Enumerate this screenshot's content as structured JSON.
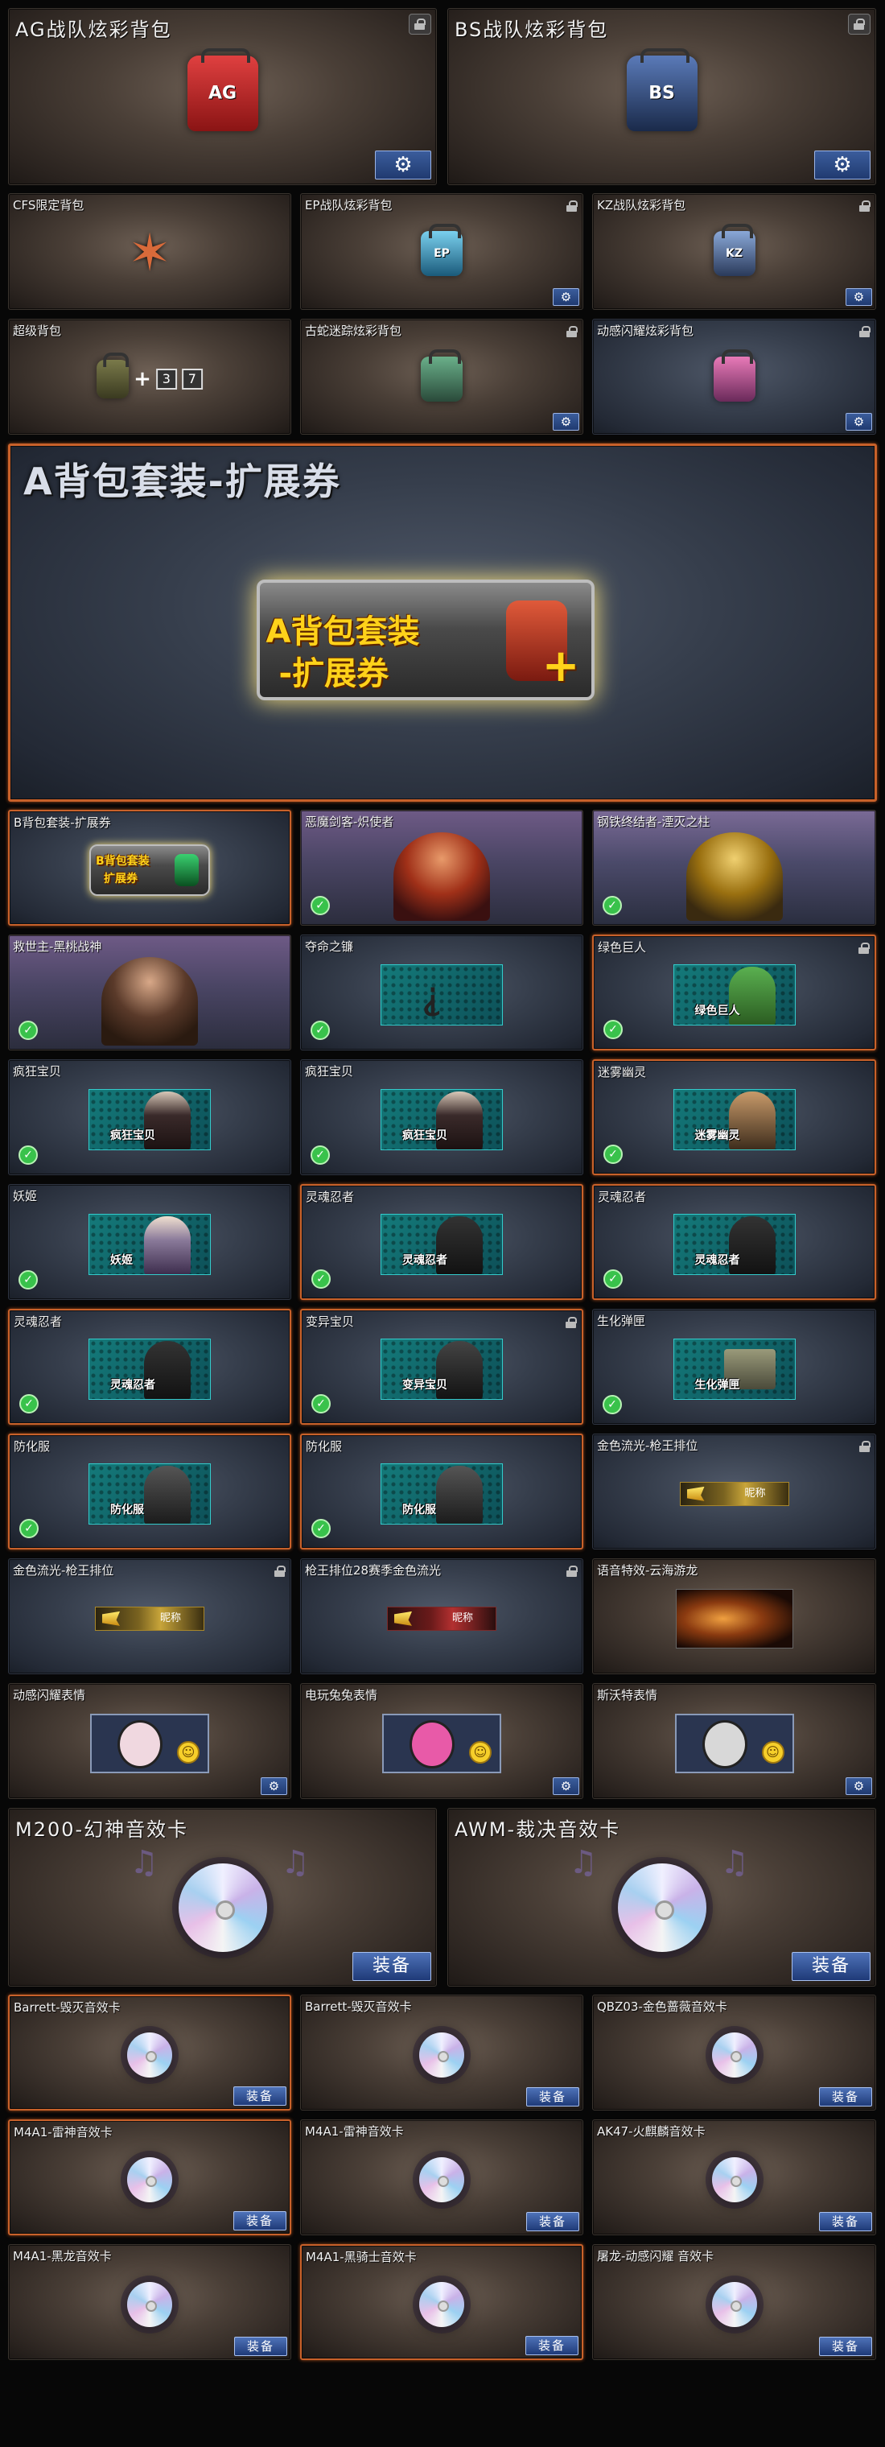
{
  "colors": {
    "accent_border": "#c8612a",
    "button_blue": "#2d4f8f",
    "confirm_green": "#39c24b"
  },
  "cards": {
    "ag_bag": {
      "title": "AG战队炫彩背包",
      "art_text": "AG",
      "color": "#c82828"
    },
    "bs_bag": {
      "title": "BS战队炫彩背包",
      "art_text": "BS",
      "color": "#2e4f8a"
    },
    "cfs_bag": {
      "title": "CFS限定背包"
    },
    "ep_bag": {
      "title": "EP战队炫彩背包",
      "art_text": "EP",
      "color": "#3aa0c8"
    },
    "kz_bag": {
      "title": "KZ战队炫彩背包",
      "art_text": "KZ",
      "color": "#3b5a8c"
    },
    "super_bag": {
      "title": "超级背包",
      "plus": "+",
      "tag1": "3",
      "tag2": "7"
    },
    "snake_bag": {
      "title": "古蛇迷踪炫彩背包",
      "color": "#4a8a6a"
    },
    "anime_bag": {
      "title": "动感闪耀炫彩背包",
      "color": "#c84a8a"
    },
    "a_ticket": {
      "title": "A背包套装-扩展券",
      "art_line1": "A背包套装",
      "art_line2": "-扩展券"
    },
    "b_ticket": {
      "title": "B背包套装-扩展券",
      "art_line1": "B背包套装",
      "art_line2": "扩展券"
    },
    "c_angel": {
      "title": "恶魔剑客-炽使者"
    },
    "c_steel": {
      "title": "钢铁终结者-湮灭之柱"
    },
    "c_savior": {
      "title": "救世主-黑桃战神"
    },
    "c_reaper": {
      "title": "夺命之镰"
    },
    "c_giant": {
      "title": "绿色巨人",
      "label": "绿色巨人"
    },
    "c_crazy1": {
      "title": "疯狂宝贝",
      "label": "疯狂宝贝"
    },
    "c_crazy2": {
      "title": "疯狂宝贝",
      "label": "疯狂宝贝"
    },
    "c_fog": {
      "title": "迷雾幽灵",
      "label": "迷雾幽灵"
    },
    "c_ji": {
      "title": "妖姬",
      "label": "妖姬"
    },
    "c_ghost1": {
      "title": "灵魂忍者",
      "label": "灵魂忍者"
    },
    "c_ghost2": {
      "title": "灵魂忍者",
      "label": "灵魂忍者"
    },
    "c_ghost3": {
      "title": "灵魂忍者",
      "label": "灵魂忍者"
    },
    "c_mutant": {
      "title": "变异宝贝",
      "label": "变异宝贝"
    },
    "c_bio": {
      "title": "生化弹匣",
      "label": "生化弹匣"
    },
    "c_hazmat1": {
      "title": "防化服",
      "label": "防化服"
    },
    "c_hazmat2": {
      "title": "防化服",
      "label": "防化服"
    },
    "n_gold1": {
      "title": "金色流光-枪王排位",
      "label": "昵称"
    },
    "n_gold2": {
      "title": "金色流光-枪王排位",
      "label": "昵称"
    },
    "n_season": {
      "title": "枪王排位28赛季金色流光",
      "label": "昵称"
    },
    "fx_dragon": {
      "title": "语音特效-云海游龙"
    },
    "e_anime": {
      "title": "动感闪耀表情"
    },
    "e_rabbit": {
      "title": "电玩兔兔表情"
    },
    "e_st": {
      "title": "斯沃特表情"
    },
    "m_m200": {
      "title": "M200-幻神音效卡",
      "button": "装备"
    },
    "m_awm": {
      "title": "AWM-裁决音效卡",
      "button": "装备"
    },
    "m_barrett1": {
      "title": "Barrett-毁灭音效卡",
      "button": "装备"
    },
    "m_barrett2": {
      "title": "Barrett-毁灭音效卡",
      "button": "装备"
    },
    "m_qbz": {
      "title": "QBZ03-金色蔷薇音效卡",
      "button": "装备"
    },
    "m_m4a1_1": {
      "title": "M4A1-雷神音效卡",
      "button": "装备"
    },
    "m_m4a1_2": {
      "title": "M4A1-雷神音效卡",
      "button": "装备"
    },
    "m_ak47": {
      "title": "AK47-火麒麟音效卡",
      "button": "装备"
    },
    "m_m4a1_dragon": {
      "title": "M4A1-黑龙音效卡",
      "button": "装备"
    },
    "m_m4a1_knight": {
      "title": "M4A1-黑骑士音效卡",
      "button": "装备"
    },
    "m_anime": {
      "title": "屠龙-动感闪耀 音效卡",
      "button": "装备"
    }
  },
  "icons": {
    "gear": "gear-icon",
    "lock": "lock-icon",
    "check": "check-icon"
  },
  "glyphs": {
    "gear": "⚙",
    "check": "✓",
    "note": "♫",
    "smile": "☺"
  }
}
